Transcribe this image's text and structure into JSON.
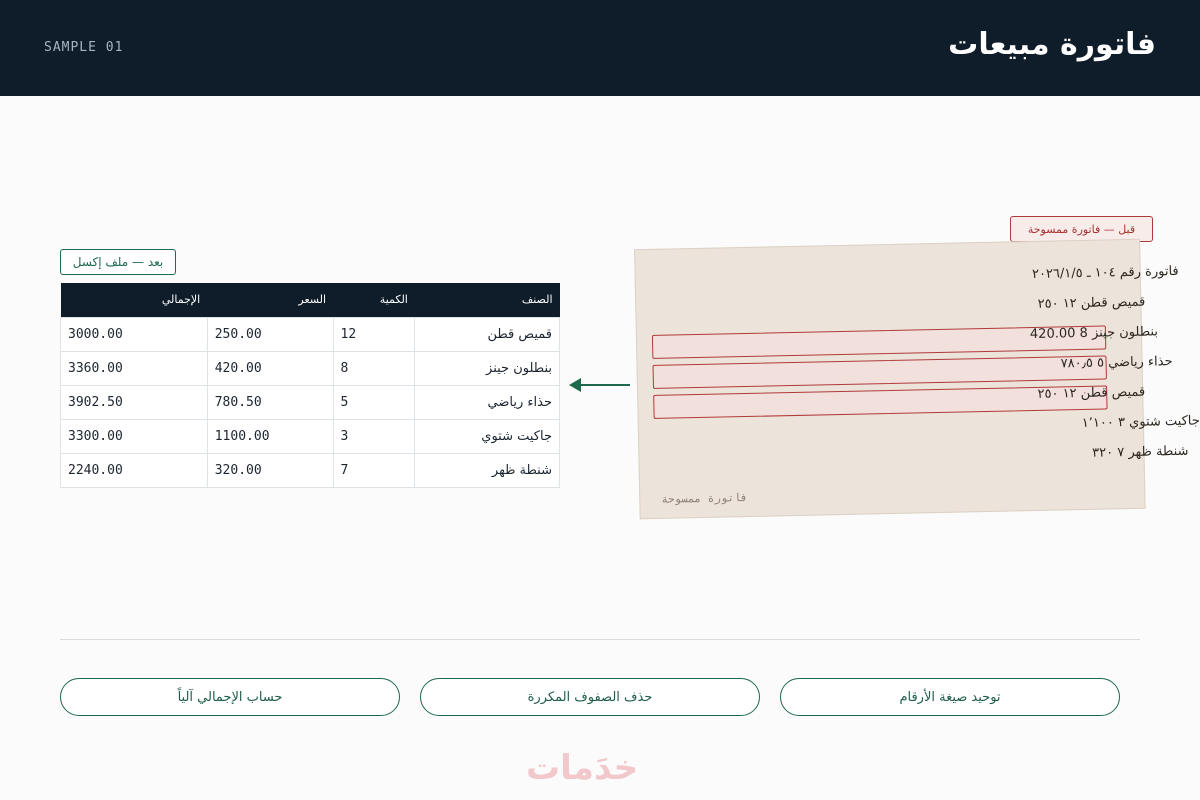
{
  "header": {
    "title": "فاتورة مبيعات",
    "sample": "SAMPLE 01"
  },
  "after": {
    "tag": "بعد — ملف إكسل",
    "columns": [
      "الصنف",
      "الكمية",
      "السعر",
      "الإجمالي"
    ],
    "rows": [
      {
        "item": "قميص قطن",
        "qty": "12",
        "price": "250.00",
        "total": "3000.00"
      },
      {
        "item": "بنطلون جينز",
        "qty": "8",
        "price": "420.00",
        "total": "3360.00"
      },
      {
        "item": "حذاء رياضي",
        "qty": "5",
        "price": "780.50",
        "total": "3902.50"
      },
      {
        "item": "جاكيت شتوي",
        "qty": "3",
        "price": "1100.00",
        "total": "3300.00"
      },
      {
        "item": "شنطة ظهر",
        "qty": "7",
        "price": "320.00",
        "total": "2240.00"
      }
    ]
  },
  "before": {
    "tag": "قبل — فاتورة ممسوحة",
    "lines": [
      "فاتورة رقم ١٠٤ ـ ٢٠٢٦/١/٥",
      "قميص قطن ١٢ ٢٥٠",
      "بنطلون جينز 8 420.00",
      "حذاء رياضي ٥ ٧٨٠٫٥",
      "قميص قطن ١٢ ٢٥٠",
      "جاكيت شتوي ٣ ١٬١٠٠",
      "شنطة ظهر ٧ ٣٢٠"
    ],
    "footer": "فاتورة ممسوحة"
  },
  "actions": {
    "normalize": "توحيد صيغة الأرقام",
    "dedupe": "حذف الصفوف المكررة",
    "autosum": "حساب الإجمالي آلياً"
  },
  "brand": {
    "logo": "خدَمات"
  },
  "colors": {
    "header_bg": "#0f1c2a",
    "accent_green": "#1e6a4c",
    "accent_red": "#b03a3a",
    "scan_bg": "#ece4da"
  },
  "icons": {
    "arrow": "arrow-left-icon"
  }
}
